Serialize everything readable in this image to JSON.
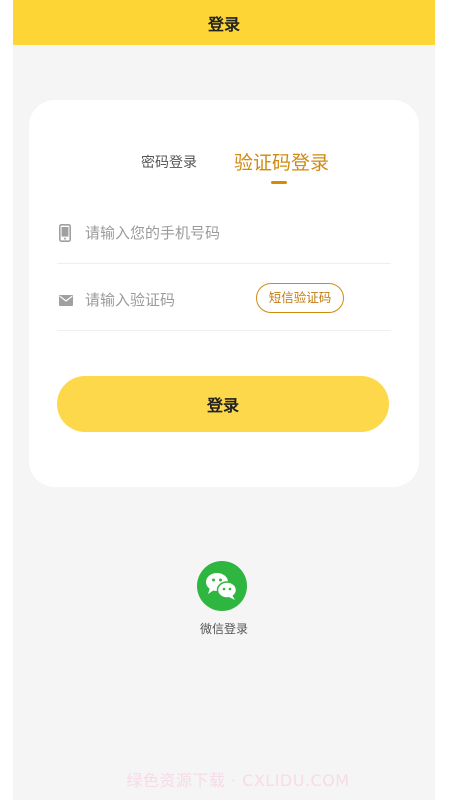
{
  "header": {
    "title": "登录"
  },
  "tabs": {
    "password": "密码登录",
    "code": "验证码登录"
  },
  "form": {
    "phone": {
      "placeholder": "请输入您的手机号码",
      "value": ""
    },
    "code": {
      "placeholder": "请输入验证码",
      "value": ""
    },
    "sms_button_label": "短信验证码",
    "login_label": "登录"
  },
  "social": {
    "wechat_label": "微信登录"
  },
  "watermark": "绿色资源下载 · CXLIDU.COM",
  "colors": {
    "header_bg": "#fdd535",
    "accent": "#d08a10",
    "login_button": "#fdd84a",
    "wechat_green": "#2fb640"
  },
  "icons": {
    "phone": "phone-icon",
    "mail": "mail-icon",
    "wechat": "wechat-icon"
  }
}
